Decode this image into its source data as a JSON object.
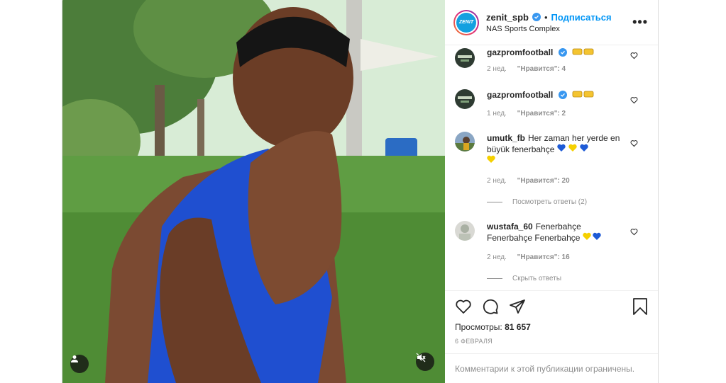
{
  "post": {
    "username": "zenit_spb",
    "follow_label": "Подписаться",
    "dot": "•",
    "location": "NAS Sports Complex",
    "more_label": "•••"
  },
  "comments": [
    {
      "user": "gazpromfootball",
      "text": "",
      "age": "2 нед.",
      "likes": "\"Нравится\": 4"
    },
    {
      "user": "gazpromfootball",
      "text": "",
      "age": "1 нед.",
      "likes": "\"Нравится\": 2"
    },
    {
      "user": "umutk_fb",
      "text": "Her zaman her yerde en büyük fenerbahçe",
      "age": "2 нед.",
      "likes": "\"Нравится\": 20",
      "replies": "Посмотреть ответы (2)"
    },
    {
      "user": "wustafa_60",
      "text": "Fenerbahçe Fenerbahçe Fenerbahçe",
      "age": "2 нед.",
      "likes": "\"Нравится\": 16",
      "replies": "Скрыть ответы"
    }
  ],
  "actions": {
    "views_label": "Просмотры:",
    "views_count": "81 657",
    "date": "6 ФЕВРАЛЯ"
  },
  "footer": {
    "restricted_text": "Комментарии к этой публикации ограничены."
  },
  "icons": [
    "user-icon",
    "mute-icon",
    "heart-icon",
    "comment-icon",
    "share-icon",
    "bookmark-icon",
    "verified-icon",
    "more-icon"
  ],
  "colors": {
    "accent": "#0095f6",
    "verified": "#3897f0",
    "muted": "#8e8e8e"
  }
}
